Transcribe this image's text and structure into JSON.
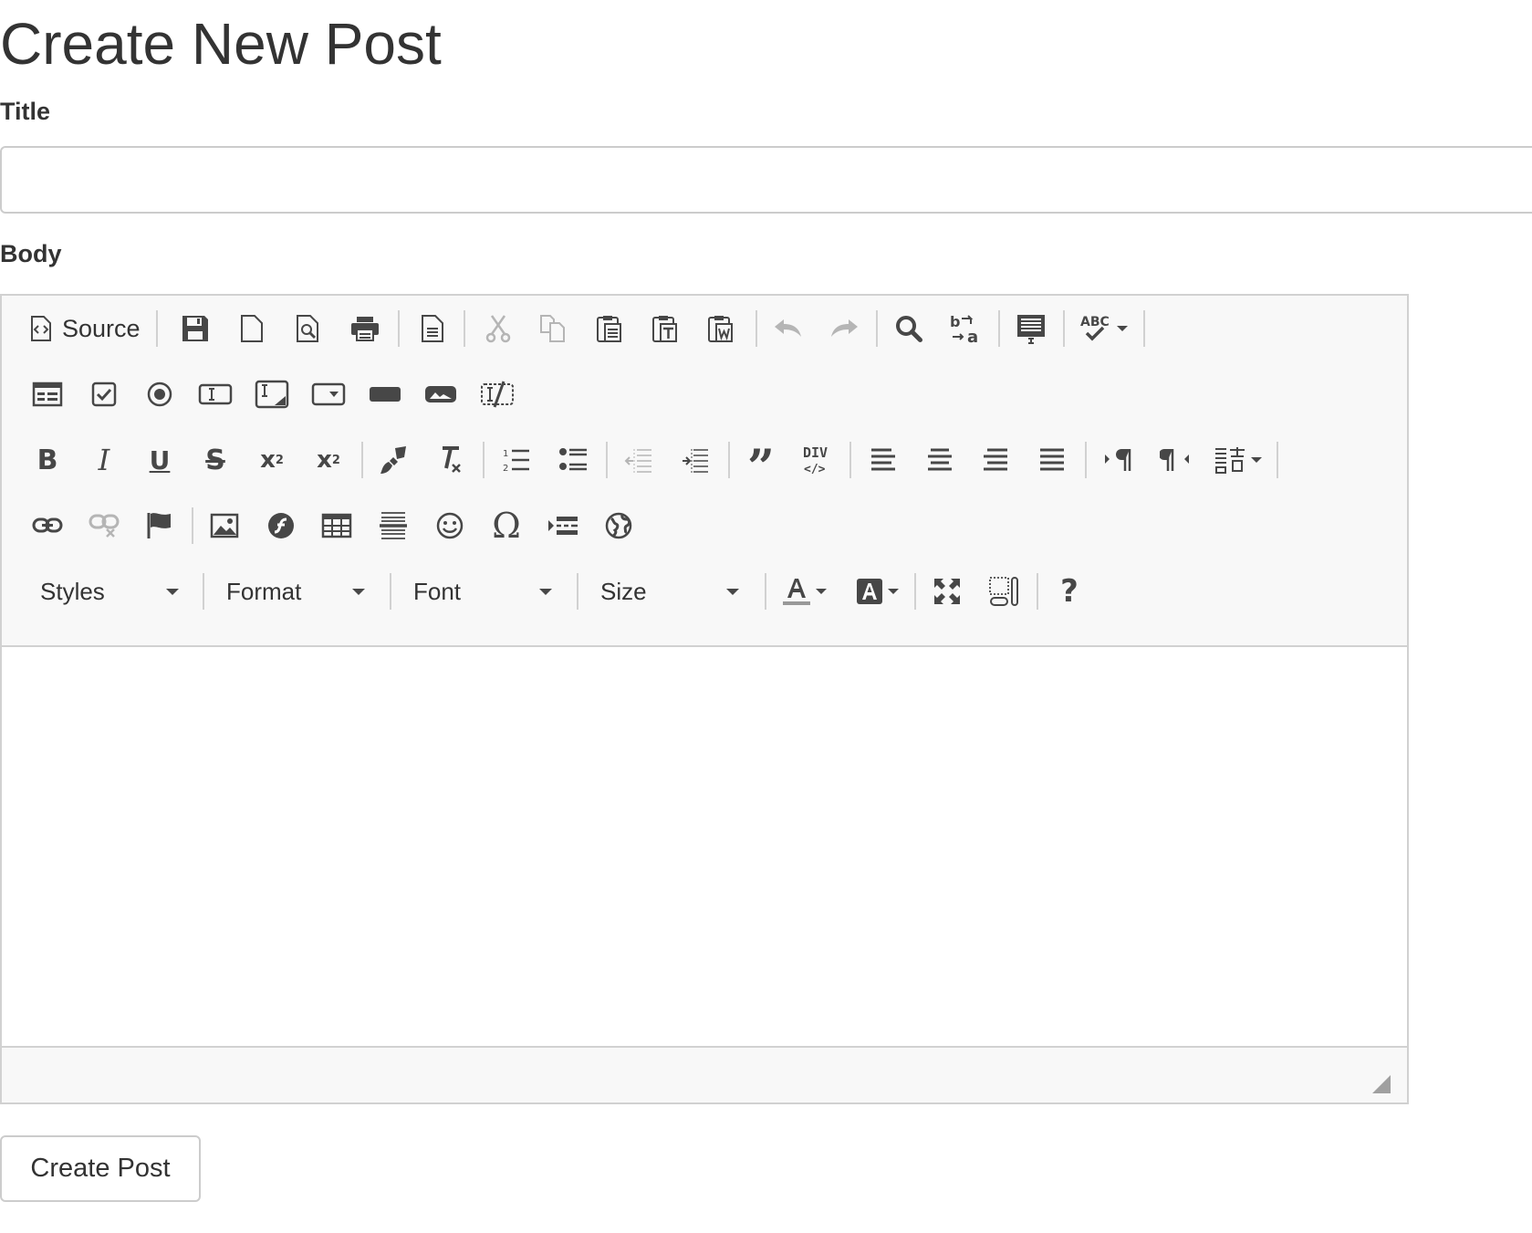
{
  "page": {
    "heading": "Create New Post"
  },
  "form": {
    "title_label": "Title",
    "title_value": "",
    "body_label": "Body",
    "submit_label": "Create Post"
  },
  "editor": {
    "source_label": "Source",
    "combos": {
      "styles": "Styles",
      "format": "Format",
      "font": "Font",
      "size": "Size"
    },
    "buttons": {
      "bold": "B",
      "italic": "I",
      "underline": "U",
      "strike": "S",
      "subscript": "x",
      "superscript": "x",
      "sub_index": "2",
      "sup_index": "2",
      "omega": "Ω",
      "help": "?",
      "div": "DIV",
      "div_code": "</>",
      "abc": "ABC",
      "quote": "”"
    }
  }
}
